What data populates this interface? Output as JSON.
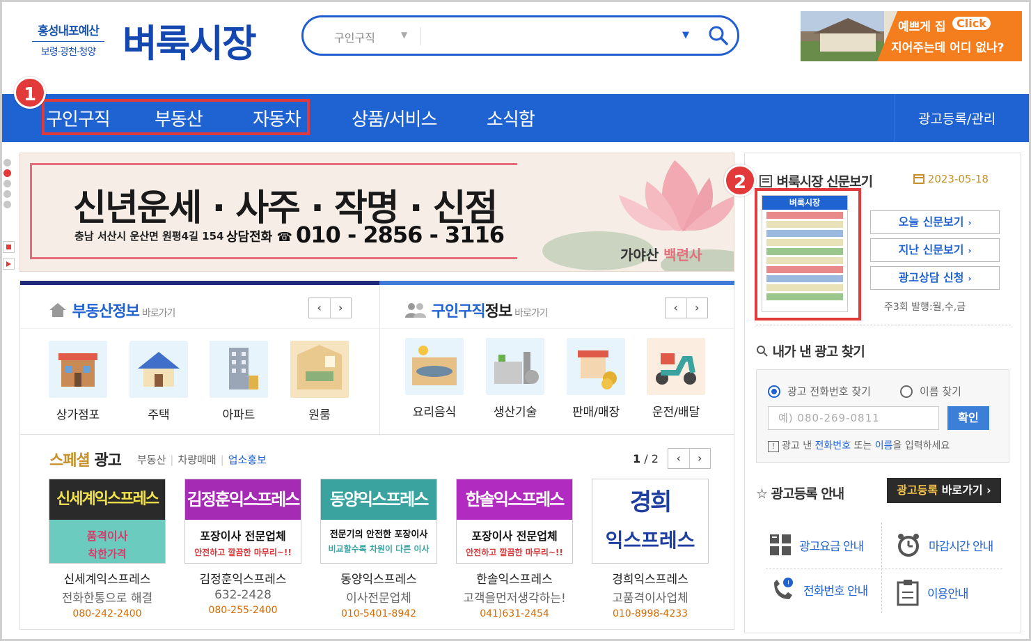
{
  "header": {
    "region_line1": "홍성내포예산",
    "region_line2": "보령·광천·청양",
    "logo": "벼룩시장",
    "search": {
      "category": "구인구직",
      "placeholder": ""
    },
    "top_ad": {
      "line1": "예쁘게 집",
      "click": "Click",
      "line2": "지어주는데 어디 없나?"
    }
  },
  "nav": {
    "items": [
      "구인구직",
      "부동산",
      "자동차",
      "상품/서비스",
      "소식함"
    ],
    "right": "광고등록/관리"
  },
  "badges": [
    "1",
    "2"
  ],
  "banner": {
    "headline": "신년운세 · 사주 · 작명 · 신점",
    "address": "충남 서산시 운산면 원평4길 154",
    "tel_label": "상담전화 ☎",
    "tel": "010 - 2856 - 3116",
    "temple_a": "가야산",
    "temple_b": "백련사"
  },
  "realestate": {
    "title": "부동산정보",
    "go": "바로가기",
    "items": [
      "상가점포",
      "주택",
      "아파트",
      "원룸"
    ]
  },
  "jobs": {
    "title": "구인구직정보",
    "go": "바로가기",
    "items": [
      "요리음식",
      "생산기술",
      "판매/매장",
      "운전/배달"
    ]
  },
  "special": {
    "title_a": "스페셜",
    "title_b": "광고",
    "tabs": [
      "부동산",
      "차량매매",
      "업소홍보"
    ],
    "page_current": "1",
    "page_total": "/ 2",
    "ads": [
      {
        "head": "신세계익스프레스",
        "l1": "품격이사",
        "l2": "착한가격",
        "name": "신세계익스프레스",
        "sub": "전화한통으로 해결",
        "tel": "080-242-2400",
        "color": "#2a2a2a"
      },
      {
        "head": "김정훈익스프레스",
        "l1": "포장이사 전문업체",
        "l2": "안전하고 깔끔한 마무리~!!",
        "name": "김정훈익스프레스",
        "sub": "632-2428",
        "tel": "080-255-2400",
        "color": "#a52bb5"
      },
      {
        "head": "동양익스프레스",
        "l1": "전문기의 안전한 포장이사",
        "l2": "비교할수록 차원이 다른 이사",
        "name": "동양익스프레스",
        "sub": "이사전문업체",
        "tel": "010-5401-8942",
        "color": "#3aa3a0"
      },
      {
        "head": "한솔익스프레스",
        "l1": "포장이사 전문업체",
        "l2": "안전하고 깔끔한 마무리~!!",
        "name": "한솔익스프레스",
        "sub": "고객을먼저생각하는!",
        "tel": "041)631-2454",
        "color": "#b22bc0"
      },
      {
        "head": "경희",
        "l1": "익스프레스",
        "l2": "",
        "name": "경희익스프레스",
        "sub": "고품격이사업체",
        "tel": "010-8998-4233",
        "color": "#ffffff"
      }
    ]
  },
  "right": {
    "paper_title": "벼룩시장 신문보기",
    "date": "2023-05-18",
    "paper_head": "벼룩시장",
    "buttons": [
      "오늘 신문보기",
      "지난 신문보기",
      "광고상담 신청"
    ],
    "note": "주3회 발행:월,수,금",
    "find_title": "내가 낸 광고 찾기",
    "radio_phone": "광고 전화번호 찾기",
    "radio_name": "이름 찾기",
    "input_placeholder": "예) 080-269-0811",
    "confirm": "확인",
    "hint_a": "광고 낸 ",
    "hint_b": "전화번호",
    "hint_c": " 또는 ",
    "hint_d": "이름",
    "hint_e": "을 입력하세요",
    "reg_title": "광고등록 안내",
    "reg_btn_a": "광고등록",
    "reg_btn_b": " 바로가기 ›",
    "info": [
      "광고요금 안내",
      "마감시간 안내",
      "전화번호 안내",
      "이용안내"
    ]
  }
}
